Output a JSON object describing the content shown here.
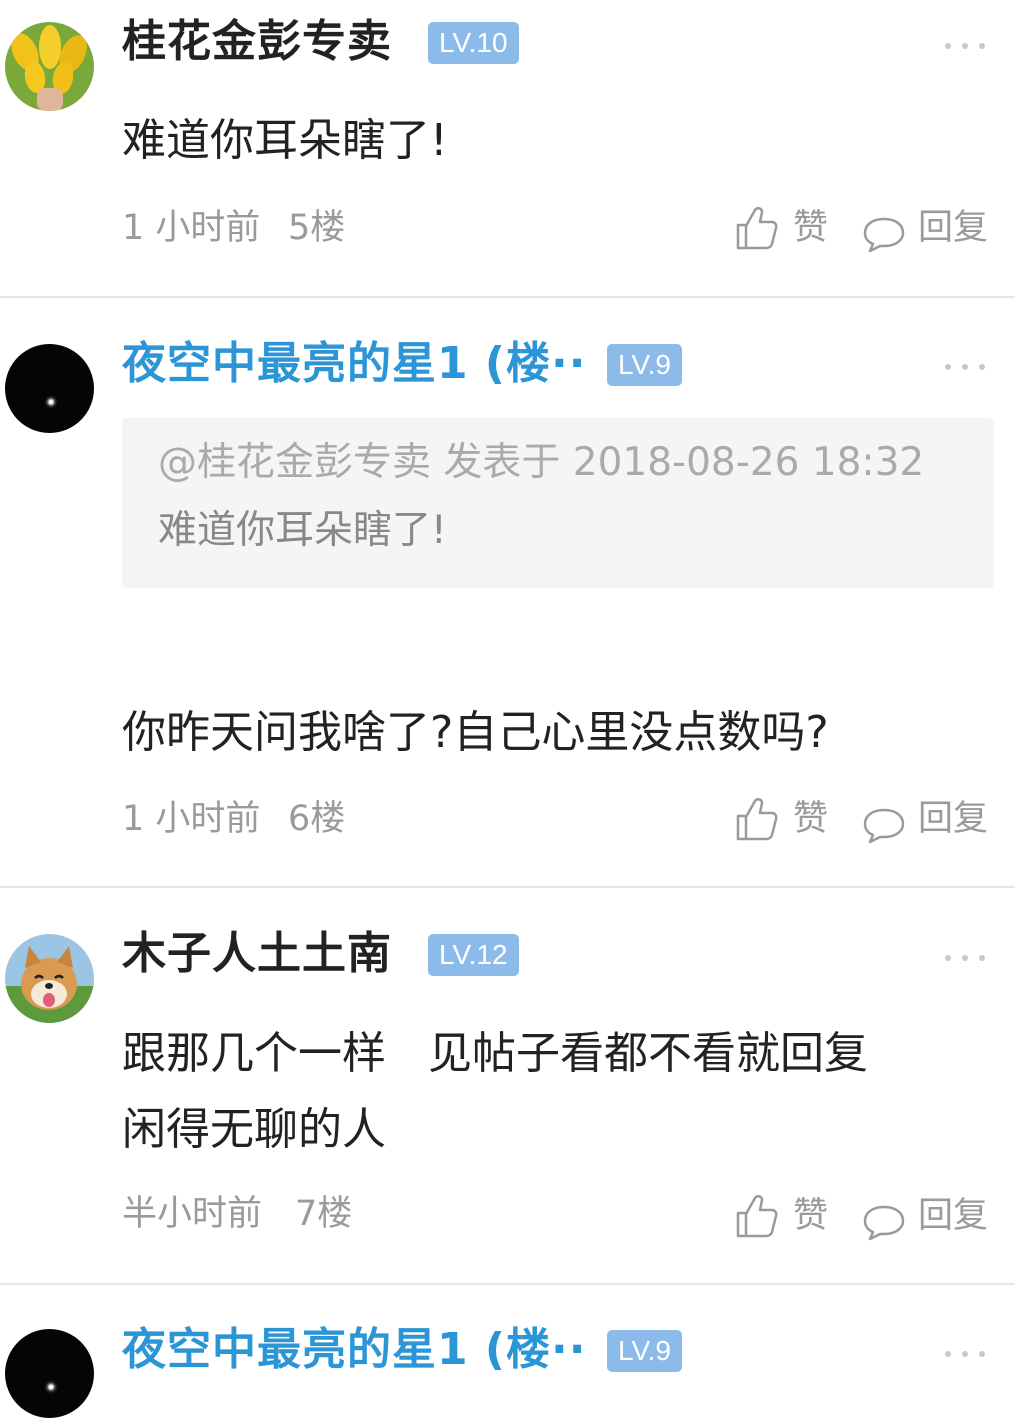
{
  "posts": [
    {
      "username": "桂花金彭专卖",
      "level": "LV.10",
      "content_lines": [
        "难道你耳朵瞎了!"
      ],
      "time": "1 小时前",
      "floor": "5楼",
      "like_label": "赞",
      "reply_label": "回复"
    },
    {
      "username": "夜空中最亮的星1 (楼··",
      "level": "LV.9",
      "quote": {
        "header": "@桂花金彭专卖  发表于 2018-08-26 18:32",
        "text": "难道你耳朵瞎了!"
      },
      "content_lines": [
        "你昨天问我啥了?自己心里没点数吗?"
      ],
      "time": "1 小时前",
      "floor": "6楼",
      "like_label": "赞",
      "reply_label": "回复"
    },
    {
      "username": "木子人土土南",
      "level": "LV.12",
      "content_lines": [
        "跟那几个一样   见帖子看都不看就回复",
        "闲得无聊的人"
      ],
      "time": "半小时前",
      "floor": "7楼",
      "like_label": "赞",
      "reply_label": "回复"
    },
    {
      "username": "夜空中最亮的星1 (楼··",
      "level": "LV.9"
    }
  ],
  "colors": {
    "op_name": "#2b95d6",
    "level_badge": "#8dbbe9",
    "meta_text": "#9a9a9a",
    "divider": "#e6e6e6",
    "quote_bg": "#f5f5f5"
  },
  "icons": {
    "like": "thumbs-up-icon",
    "reply": "speech-bubble-icon",
    "more": "more-dots-icon"
  }
}
